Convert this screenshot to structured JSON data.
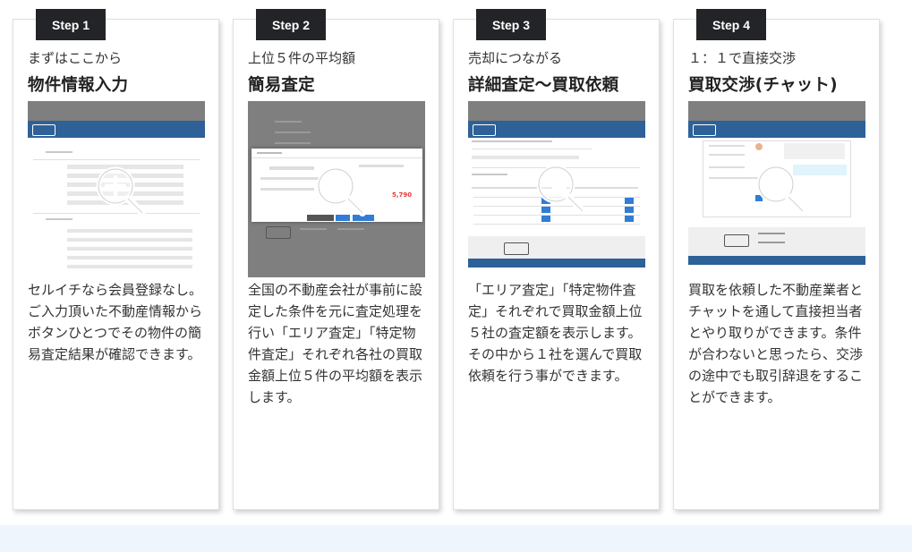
{
  "steps": [
    {
      "badge": "Step 1",
      "subtitle": "まずはここから",
      "title": "物件情報入力",
      "description": "セルイチなら会員登録なし。ご入力頂いた不動産情報からボタンひとつでその物件の簡易査定結果が確認できます。",
      "thumbnail_icon": "magnifier-zoom-icon"
    },
    {
      "badge": "Step 2",
      "subtitle": "上位５件の平均額",
      "title": "簡易査定",
      "description": "全国の不動産会社が事前に設定した条件を元に査定処理を行い「エリア査定」「特定物件査定」それぞれ各社の買取金額上位５件の平均額を表示します。",
      "thumbnail_icon": "magnifier-zoom-icon",
      "thumbnail_price": "5,790"
    },
    {
      "badge": "Step 3",
      "subtitle": "売却につながる",
      "title": "詳細査定〜買取依頼",
      "description": "「エリア査定」「特定物件査定」それぞれで買取金額上位５社の査定額を表示します。その中から１社を選んで買取依頼を行う事ができます。",
      "thumbnail_icon": "magnifier-zoom-icon"
    },
    {
      "badge": "Step 4",
      "subtitle": "１：１で直接交渉",
      "title": "買取交渉(チャット)",
      "description": "買取を依頼した不動産業者とチャットを通して直接担当者とやり取りができます。条件が合わないと思ったら、交渉の途中でも取引辞退をすることができます。",
      "thumbnail_icon": "magnifier-zoom-icon"
    }
  ],
  "colors": {
    "badge_bg": "#222427",
    "header_blue": "#2d6198",
    "overlay_gray": "#7f7f7f",
    "bottom_band": "#eef5fd",
    "price_red": "#e53935"
  }
}
